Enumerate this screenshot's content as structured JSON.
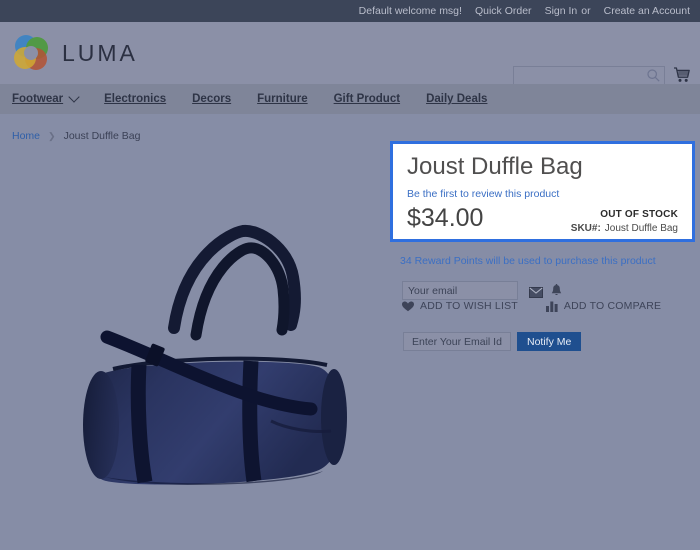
{
  "topbar": {
    "welcome_msg": "Default welcome msg!",
    "quick_order": "Quick Order",
    "sign_in": "Sign In",
    "or": "or",
    "create_account": "Create an Account"
  },
  "header": {
    "logo_text": "LUMA",
    "search_placeholder": "",
    "search_value": "",
    "search_icon": "search-icon",
    "cart_icon": "cart-icon"
  },
  "nav": {
    "items": [
      {
        "label": "Footwear",
        "has_dropdown": true
      },
      {
        "label": "Electronics",
        "has_dropdown": false
      },
      {
        "label": "Decors",
        "has_dropdown": false
      },
      {
        "label": "Furniture",
        "has_dropdown": false
      },
      {
        "label": "Gift Product",
        "has_dropdown": false
      },
      {
        "label": "Daily Deals",
        "has_dropdown": false
      }
    ]
  },
  "breadcrumb": {
    "home": "Home",
    "separator": "❯",
    "current": "Joust Duffle Bag"
  },
  "product": {
    "title": "Joust Duffle Bag",
    "review_link": "Be the first to review this product",
    "price": "$34.00",
    "stock_status": "OUT OF STOCK",
    "sku_label": "SKU#:",
    "sku_value": "Joust Duffle Bag",
    "image_alt": "navy blue duffle bag"
  },
  "reward": {
    "text": "34 Reward Points will be used to purchase this product"
  },
  "email_alert": {
    "placeholder": "Your email",
    "value": "",
    "envelope_icon": "envelope-icon",
    "bell_icon": "bell-icon"
  },
  "actions": {
    "wishlist_label": "ADD TO WISH LIST",
    "wishlist_icon": "heart-icon",
    "compare_label": "ADD TO COMPARE",
    "compare_icon": "bar-chart-icon"
  },
  "notify": {
    "placeholder": "Enter Your Email Id",
    "value": "",
    "button_label": "Notify Me"
  },
  "colors": {
    "topbar_bg": "#3c4559",
    "header_bg": "#8b90a7",
    "nav_bg": "#7f8599",
    "page_overlay": "#868da6",
    "highlight_border": "#2f6fdf",
    "link_blue": "#3b6fc4",
    "notify_button": "#1f4f8f",
    "logo_blue": "#3c84c4",
    "logo_green": "#4e9a3e",
    "logo_orange": "#b5502f",
    "logo_yellow": "#d6ab2a"
  }
}
